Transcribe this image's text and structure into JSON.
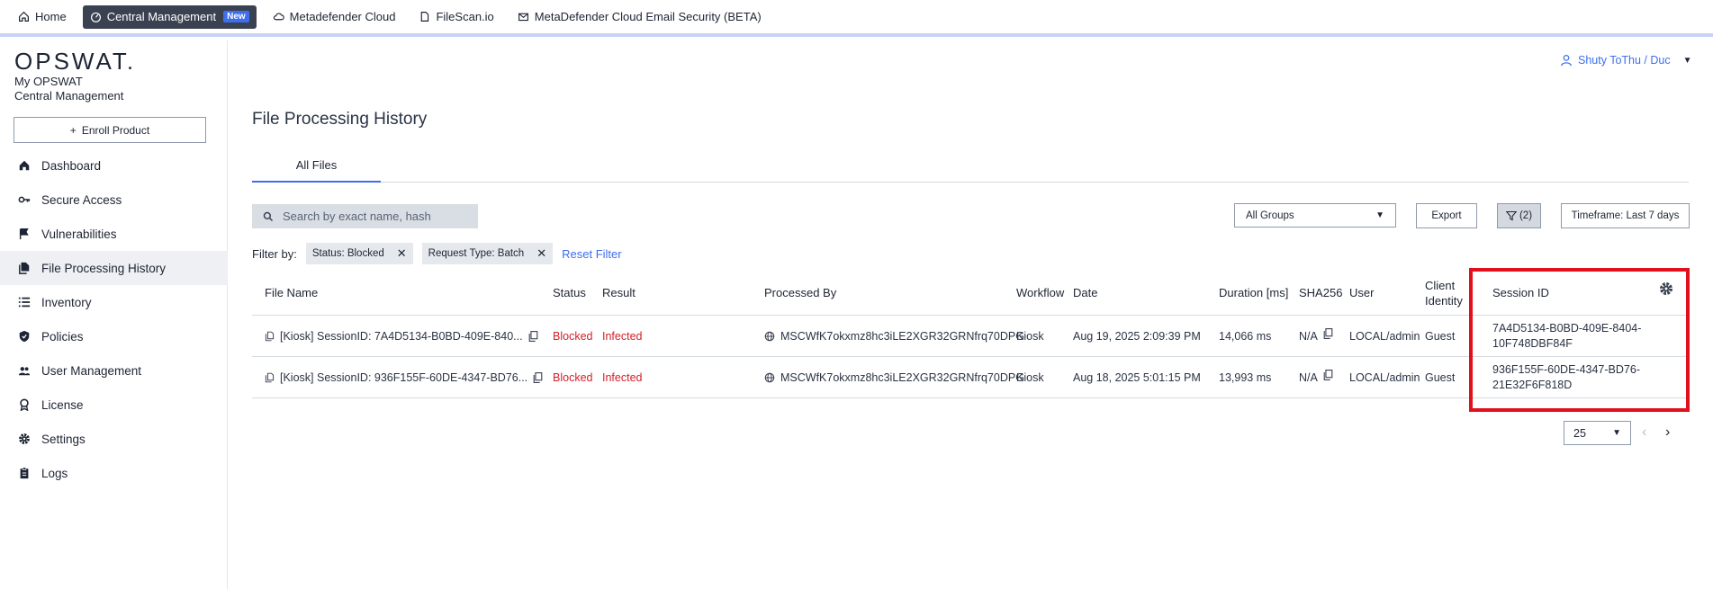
{
  "topnav": {
    "home": "Home",
    "central_management": "Central Management",
    "new_badge": "New",
    "metadefender_cloud": "Metadefender Cloud",
    "filescan": "FileScan.io",
    "email_security": "MetaDefender Cloud Email Security (BETA)"
  },
  "sidebar": {
    "logo": "OPSWAT.",
    "brand_line1": "My OPSWAT",
    "brand_line2": "Central Management",
    "enroll_label": "Enroll Product",
    "items": [
      {
        "label": "Dashboard",
        "icon": "home-icon"
      },
      {
        "label": "Secure Access",
        "icon": "key-icon"
      },
      {
        "label": "Vulnerabilities",
        "icon": "flag-icon"
      },
      {
        "label": "File Processing History",
        "icon": "file-history-icon"
      },
      {
        "label": "Inventory",
        "icon": "list-icon"
      },
      {
        "label": "Policies",
        "icon": "shield-icon"
      },
      {
        "label": "User Management",
        "icon": "users-icon"
      },
      {
        "label": "License",
        "icon": "badge-icon"
      },
      {
        "label": "Settings",
        "icon": "gear-icon"
      },
      {
        "label": "Logs",
        "icon": "clipboard-icon"
      }
    ]
  },
  "user": {
    "name": "Shuty ToThu / Duc"
  },
  "page": {
    "title": "File Processing History",
    "tab_all_files": "All Files"
  },
  "toolbar": {
    "search_placeholder": "Search by exact name, hash",
    "groups_value": "All Groups",
    "export_label": "Export",
    "filter_count": "(2)",
    "timeframe_label": "Timeframe: Last 7 days"
  },
  "filters": {
    "label": "Filter by:",
    "chips": [
      "Status: Blocked",
      "Request Type: Batch"
    ],
    "reset_label": "Reset Filter"
  },
  "table": {
    "headers": {
      "file_name": "File Name",
      "status": "Status",
      "result": "Result",
      "processed_by": "Processed By",
      "workflow": "Workflow",
      "date": "Date",
      "duration": "Duration [ms]",
      "sha256": "SHA256",
      "user": "User",
      "client_identity_1": "Client",
      "client_identity_2": "Identity",
      "session_id": "Session ID"
    },
    "rows": [
      {
        "file_name": "[Kiosk] SessionID: 7A4D5134-B0BD-409E-840...",
        "status": "Blocked",
        "result": "Infected",
        "processed_by": "MSCWfK7okxmz8hc3iLE2XGR32GRNfrq70DPG",
        "workflow": "Kiosk",
        "date": "Aug 19, 2025 2:09:39 PM",
        "duration": "14,066 ms",
        "sha256": "N/A",
        "user": "LOCAL/admin",
        "client_identity": "Guest",
        "session_id": "7A4D5134-B0BD-409E-8404-10F748DBF84F"
      },
      {
        "file_name": "[Kiosk] SessionID: 936F155F-60DE-4347-BD76...",
        "status": "Blocked",
        "result": "Infected",
        "processed_by": "MSCWfK7okxmz8hc3iLE2XGR32GRNfrq70DPG",
        "workflow": "Kiosk",
        "date": "Aug 18, 2025 5:01:15 PM",
        "duration": "13,993 ms",
        "sha256": "N/A",
        "user": "LOCAL/admin",
        "client_identity": "Guest",
        "session_id": "936F155F-60DE-4347-BD76-21E32F6F818D"
      }
    ]
  },
  "pagination": {
    "page_size": "25"
  },
  "colors": {
    "accent": "#3d6ef0",
    "danger": "#d4202a",
    "highlight": "#e0101c"
  }
}
